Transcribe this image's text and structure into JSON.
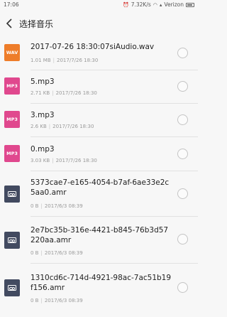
{
  "status_bar": {
    "time": "17:06",
    "network_speed": "7.32K/s",
    "carrier": "Verizon",
    "icons": [
      "alarm-icon",
      "wifi-icon",
      "signal-icon",
      "battery-icon"
    ]
  },
  "header": {
    "back_icon": "chevron-left-icon",
    "title": "选择音乐"
  },
  "files": [
    {
      "type_label": "WAV",
      "type": "wav",
      "name": "2017-07-26 18:30:07siAudio.wav",
      "size": "1.01 MB",
      "date": "2017/7/26 18:30",
      "selected": false
    },
    {
      "type_label": "MP3",
      "type": "mp3",
      "name": "5.mp3",
      "size": "2.71 KB",
      "date": "2017/7/26 18:30",
      "selected": false
    },
    {
      "type_label": "MP3",
      "type": "mp3",
      "name": "3.mp3",
      "size": "2.6 KB",
      "date": "2017/7/26 18:30",
      "selected": false
    },
    {
      "type_label": "MP3",
      "type": "mp3",
      "name": "0.mp3",
      "size": "3.03 KB",
      "date": "2017/7/26 18:30",
      "selected": false
    },
    {
      "type_label": "",
      "type": "amr",
      "name": "5373cae7-e165-4054-b7af-6ae33e2c5aa0.amr",
      "size": "0 B",
      "date": "2017/6/3 08:39",
      "selected": false
    },
    {
      "type_label": "",
      "type": "amr",
      "name": "2e7bc35b-316e-4421-b845-76b3d57220aa.amr",
      "size": "0 B",
      "date": "2017/6/3 08:39",
      "selected": false
    },
    {
      "type_label": "",
      "type": "amr",
      "name": "1310cd6c-714d-4921-98ac-7ac51b19f156.amr",
      "size": "0 B",
      "date": "2017/6/3 08:39",
      "selected": false
    }
  ]
}
